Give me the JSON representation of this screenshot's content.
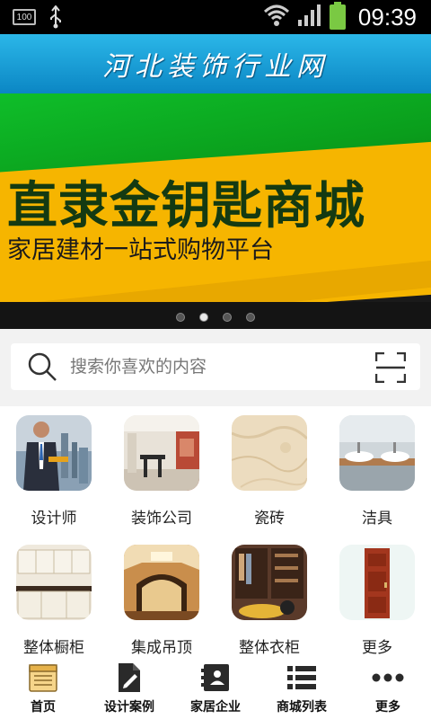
{
  "status_bar": {
    "battery_small": "100",
    "time": "09:39"
  },
  "header": {
    "title": "河北装饰行业网"
  },
  "banner": {
    "main_text": "直隶金钥匙商城",
    "sub_text": "家居建材一站式购物平台",
    "slide_count": 4,
    "active_slide": 2
  },
  "search": {
    "placeholder": "搜索你喜欢的内容"
  },
  "categories": [
    {
      "label": "设计师",
      "icon": "designer-image"
    },
    {
      "label": "装饰公司",
      "icon": "decoration-company-image"
    },
    {
      "label": "瓷砖",
      "icon": "tile-image"
    },
    {
      "label": "洁具",
      "icon": "sanitary-ware-image"
    },
    {
      "label": "整体橱柜",
      "icon": "kitchen-cabinet-image"
    },
    {
      "label": "集成吊顶",
      "icon": "ceiling-image"
    },
    {
      "label": "整体衣柜",
      "icon": "wardrobe-image"
    },
    {
      "label": "更多",
      "icon": "door-image"
    }
  ],
  "bottom_nav": [
    {
      "label": "首页",
      "icon": "home-icon"
    },
    {
      "label": "设计案例",
      "icon": "design-case-icon"
    },
    {
      "label": "家居企业",
      "icon": "company-icon"
    },
    {
      "label": "商城列表",
      "icon": "list-icon"
    },
    {
      "label": "更多",
      "icon": "more-icon"
    }
  ],
  "colors": {
    "header_top": "#2bb7e8",
    "header_bottom": "#0b86c4",
    "banner_green": "#0fbf2a",
    "banner_yellow": "#f6b500",
    "battery": "#7ac943"
  }
}
